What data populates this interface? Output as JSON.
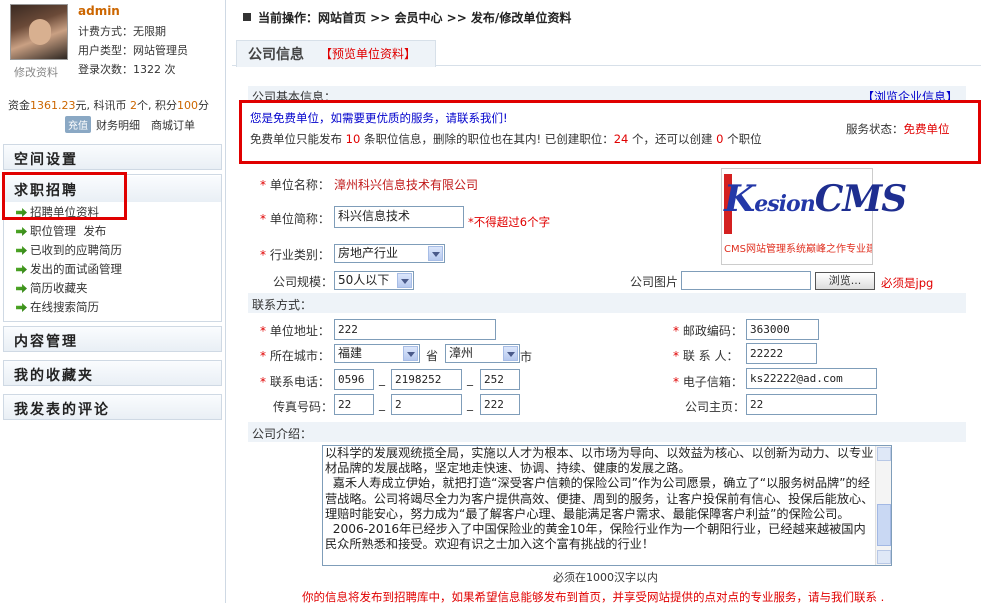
{
  "sidebar": {
    "username": "admin",
    "billing": "计费方式：无限期",
    "user_type": "用户类型：网站管理员",
    "logins": "登录次数：1322 次",
    "edit_profile": "修改资料",
    "funds_prefix": "资金",
    "funds_value": "1361.23",
    "funds_mid": "元, 科讯币 ",
    "coins_value": "2",
    "coins_mid": "个, 积分",
    "points_value": "100",
    "points_unit": "分",
    "recharge": "充值",
    "finance": "财务明细",
    "orders": "商城订单",
    "sections": {
      "space": "空间设置",
      "recruit": "求职招聘",
      "content": "内容管理",
      "favorites": "我的收藏夹",
      "comments": "我发表的评论"
    },
    "recruit_items": [
      "招聘单位资料",
      "职位管理",
      "已收到的应聘简历",
      "发出的面试函管理",
      "简历收藏夹",
      "在线搜索简历"
    ],
    "publish": "发布"
  },
  "breadcrumb": "当前操作：网站首页 >> 会员中心 >> 发布/修改单位资料",
  "tabs": {
    "company": "公司信息",
    "preview": "【预览单位资料】"
  },
  "basic_info": "公司基本信息：",
  "browse_company": "【浏览企业信息】",
  "notice": {
    "line1": "您是免费单位，如需要更优质的服务，请联系我们!",
    "line2_a": "免费单位只能发布 ",
    "limit": "10",
    "line2_b": " 条职位信息，删除的职位也在其内!   已创建职位：",
    "created": "24",
    "line2_c": " 个，还可以创建 ",
    "remaining": "0",
    "line2_d": " 个职位",
    "status_label": "服务状态：",
    "status_value": "免费单位"
  },
  "form": {
    "company_name_label": "单位名称：",
    "company_name": "漳州科兴信息技术有限公司",
    "short_name_label": "单位简称：",
    "short_name": "科兴信息技术",
    "short_hint": "*不得超过6个字",
    "industry_label": "行业类别：",
    "industry": "房地产行业",
    "scale_label": "公司规模：",
    "scale": "50人以下",
    "image_label": "公司图片",
    "browse": "浏览...",
    "jpg_hint": "必须是jpg",
    "contact_label": "联系方式：",
    "address_label": "单位地址：",
    "address": "222",
    "zip_label": "邮政编码：",
    "zip": "363000",
    "city_label": "所在城市：",
    "province": "福建",
    "province_unit": "省",
    "city": "漳州",
    "city_unit": "市",
    "contact_person_label": "联 系 人：",
    "contact_person": "22222",
    "phone_label": "联系电话：",
    "phone1": "0596",
    "phone2": "2198252",
    "phone3": "252",
    "email_label": "电子信箱：",
    "email": "ks22222@ad.com",
    "fax_label": "传真号码：",
    "fax1": "22",
    "fax2": "2",
    "fax3": "222",
    "homepage_label": "公司主页：",
    "homepage": "22",
    "dash": "_",
    "intro_label": "公司介绍：",
    "intro": "以科学的发展观统揽全局，实施以人才为根本、以市场为导向、以效益为核心、以创新为动力、以专业材品牌的发展战略，坚定地走快速、协调、持续、健康的发展之路。\n  嘉禾人寿成立伊始，就把打造“深受客户信赖的保险公司”作为公司愿景，确立了“以服务树品牌”的经营战略。公司将竭尽全力为客户提供高效、便捷、周到的服务，让客户投保前有信心、投保后能放心、理赔时能安心，努力成为“最了解客户心理、最能满足客户需求、最能保障客户利益”的保险公司。\n  2006-2016年已经步入了中国保险业的黄金10年，保险行业作为一个朝阳行业，已经越来越被国内民众所熟悉和接受。欢迎有识之士加入这个富有挑战的行业！",
    "intro_hint": "必须在1000汉字以内",
    "footer": "你的信息将发布到招聘库中，如果希望信息能够发布到首页，并享受网站提供的点对点的专业服务，请与我们联系 ."
  },
  "logo": {
    "brand_k": "K",
    "brand_rest": "esion",
    "brand_cms": "CMS",
    "tagline": "CMS网站管理系统巅峰之作专业建站软件"
  },
  "colors": {
    "accent_red": "#e00000",
    "link_blue": "#0000cc",
    "panel_bg": "#eef3f8"
  }
}
